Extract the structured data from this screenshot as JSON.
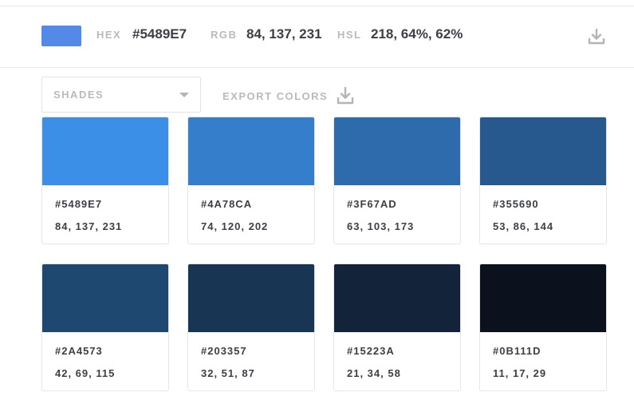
{
  "header": {
    "swatch_color": "#5489E7",
    "hex_label": "HEX",
    "hex_value": "#5489E7",
    "rgb_label": "RGB",
    "rgb_value": "84, 137, 231",
    "hsl_label": "HSL",
    "hsl_value": "218, 64%, 62%",
    "download_icon": "download-icon"
  },
  "controls": {
    "shades_label": "SHADES",
    "export_label": "EXPORT COLORS",
    "export_icon": "download-icon"
  },
  "shades": [
    {
      "color": "#3C8FE6",
      "hex": "#5489E7",
      "rgb": "84, 137, 231"
    },
    {
      "color": "#347ECC",
      "hex": "#4A78CA",
      "rgb": "74, 120, 202"
    },
    {
      "color": "#2E6BAC",
      "hex": "#3F67AD",
      "rgb": "63, 103, 173"
    },
    {
      "color": "#27598E",
      "hex": "#355690",
      "rgb": "53, 86, 144"
    },
    {
      "color": "#1F4870",
      "hex": "#2A4573",
      "rgb": "42, 69, 115"
    },
    {
      "color": "#183554",
      "hex": "#203357",
      "rgb": "32, 51, 87"
    },
    {
      "color": "#12233A",
      "hex": "#15223A",
      "rgb": "21, 34, 58"
    },
    {
      "color": "#0C121D",
      "hex": "#0B111D",
      "rgb": "11, 17, 29"
    }
  ]
}
